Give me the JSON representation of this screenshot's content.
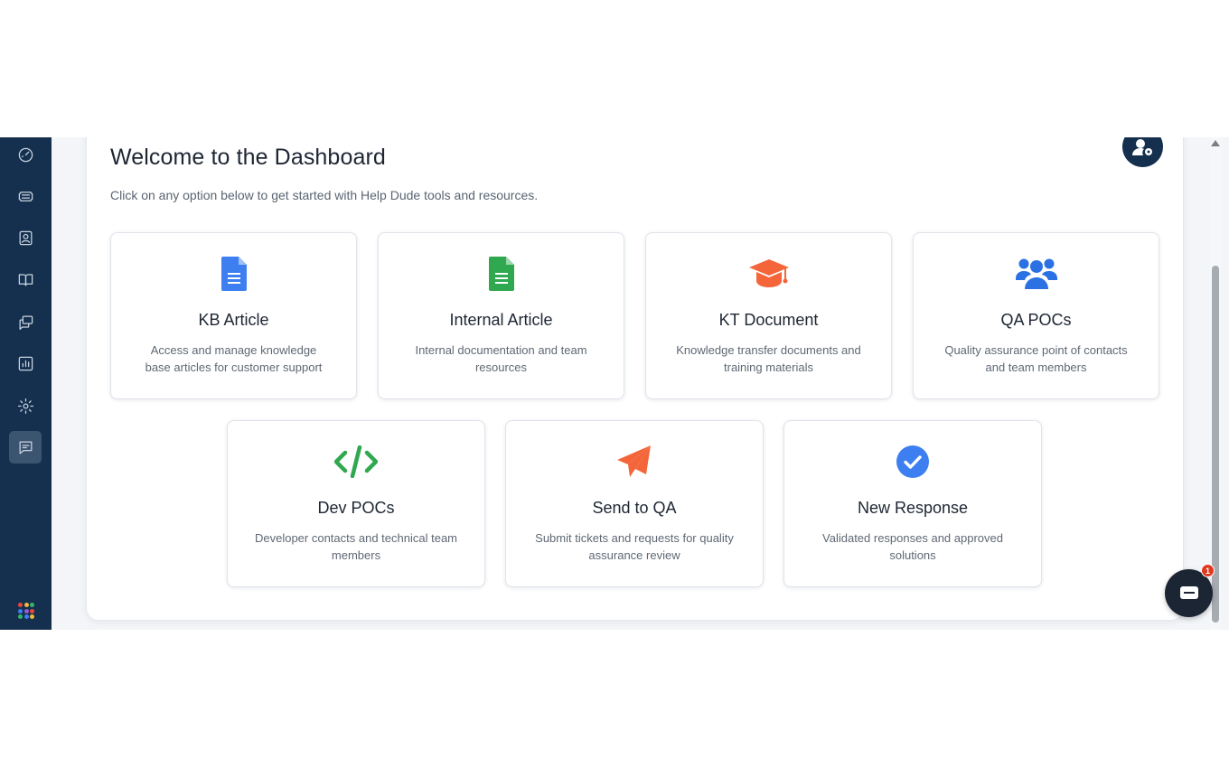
{
  "header": {
    "title": "Welcome to the Dashboard",
    "subtitle": "Click on any option below to get started with Help Dude tools and resources."
  },
  "sidebar": {
    "items": [
      {
        "icon": "dashboard-gauge-icon",
        "active": false
      },
      {
        "icon": "ticket-icon",
        "active": false
      },
      {
        "icon": "contacts-icon",
        "active": false
      },
      {
        "icon": "book-icon",
        "active": false
      },
      {
        "icon": "messages-icon",
        "active": false
      },
      {
        "icon": "reports-chart-icon",
        "active": false
      },
      {
        "icon": "settings-gear-icon",
        "active": false
      },
      {
        "icon": "chat-feedback-icon",
        "active": true
      }
    ],
    "bottom_icon": "apps-grid-icon"
  },
  "cards": [
    {
      "title": "KB Article",
      "description": "Access and manage knowledge base articles for customer support",
      "icon": "document-icon",
      "color": "#3d7ff0"
    },
    {
      "title": "Internal Article",
      "description": "Internal documentation and team resources",
      "icon": "document-icon",
      "color": "#2fa84f"
    },
    {
      "title": "KT Document",
      "description": "Knowledge transfer documents and training materials",
      "icon": "graduation-cap-icon",
      "color": "#f4663a"
    },
    {
      "title": "QA POCs",
      "description": "Quality assurance point of contacts and team members",
      "icon": "users-group-icon",
      "color": "#2b71e3"
    },
    {
      "title": "Dev POCs",
      "description": "Developer contacts and technical team members",
      "icon": "code-icon",
      "color": "#2fa84f"
    },
    {
      "title": "Send to QA",
      "description": "Submit tickets and requests for quality assurance review",
      "icon": "paper-plane-icon",
      "color": "#f4663a"
    },
    {
      "title": "New Response",
      "description": "Validated responses and approved solutions",
      "icon": "check-circle-icon",
      "color": "#3d7ff0"
    }
  ],
  "chat_widget": {
    "badge_count": "1"
  },
  "colors": {
    "sidebar": "#15304e",
    "background": "#f3f5f8",
    "card_border": "#dfe3e9"
  }
}
